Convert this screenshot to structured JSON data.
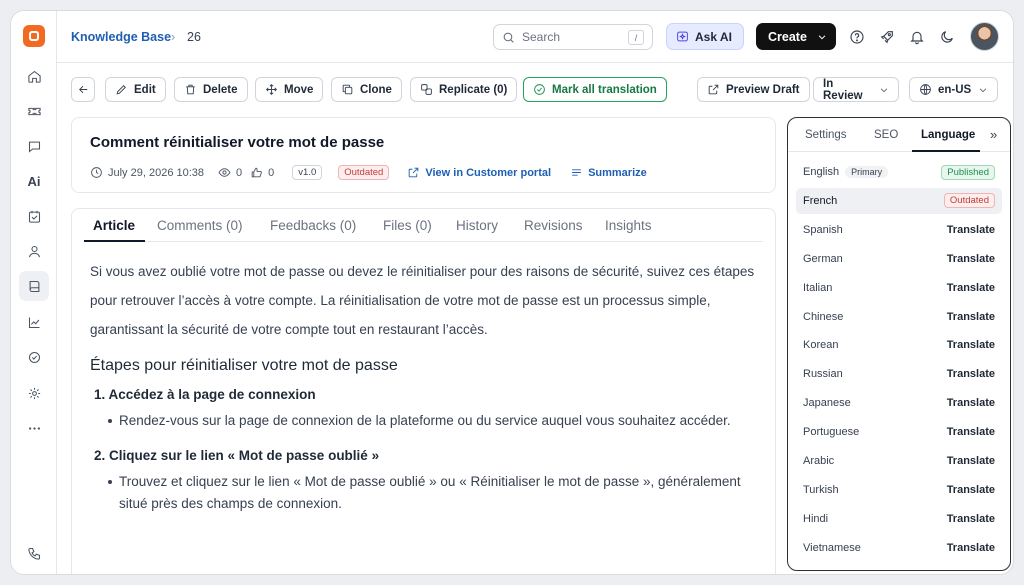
{
  "header": {
    "breadcrumb_root": "Knowledge Base",
    "breadcrumb_sep": "›",
    "breadcrumb_current": "26",
    "search_placeholder": "Search",
    "search_shortcut": "/",
    "ask_ai": "Ask AI",
    "create": "Create"
  },
  "sidebar": {
    "ai_label": "Ai"
  },
  "toolbar": {
    "edit": "Edit",
    "delete": "Delete",
    "move": "Move",
    "clone": "Clone",
    "replicate": "Replicate (0)",
    "mark_all": "Mark all translation",
    "preview": "Preview Draft",
    "status": "In Review",
    "locale": "en-US"
  },
  "article": {
    "title": "Comment réinitialiser votre mot de passe",
    "date": "July 29, 2026 10:38",
    "views": "0",
    "likes": "0",
    "version": "v1.0",
    "status_badge": "Outdated",
    "view_portal": "View in Customer portal",
    "summarize": "Summarize",
    "tabs": [
      "Article",
      "Comments (0)",
      "Feedbacks (0)",
      "Files (0)",
      "History",
      "Revisions",
      "Insights"
    ],
    "intro": "Si vous avez oublié votre mot de passe ou devez le réinitialiser pour des raisons de sécurité, suivez ces étapes pour retrouver l’accès à votre compte. La réinitialisation de votre mot de passe est un processus simple, garantissant la sécurité de votre compte tout en restaurant l’accès.",
    "heading": "Étapes pour réinitialiser votre mot de passe",
    "steps": [
      {
        "title": "1. Accédez à la page de connexion",
        "bullet": "Rendez-vous sur la page de connexion de la plateforme ou du service auquel vous souhaitez accéder."
      },
      {
        "title": "2. Cliquez sur le lien « Mot de passe oublié »",
        "bullet": "Trouvez et cliquez sur le lien « Mot de passe oublié » ou « Réinitialiser le mot de passe », généralement situé près des champs de connexion."
      }
    ]
  },
  "language_panel": {
    "tabs": [
      "Settings",
      "SEO",
      "Language"
    ],
    "active_tab": "Language",
    "expand": "»",
    "primary_badge": "Primary",
    "published_badge": "Published",
    "outdated_badge": "Outdated",
    "translate_label": "Translate",
    "languages": [
      "English",
      "French",
      "Spanish",
      "German",
      "Italian",
      "Chinese",
      "Korean",
      "Russian",
      "Japanese",
      "Portuguese",
      "Arabic",
      "Turkish",
      "Hindi",
      "Vietnamese"
    ]
  },
  "colors": {
    "brand": "#f26a21",
    "link": "#1e5fb4",
    "success": "#1a8f4d",
    "danger": "#c43b3b",
    "primary_button": "#111111"
  }
}
